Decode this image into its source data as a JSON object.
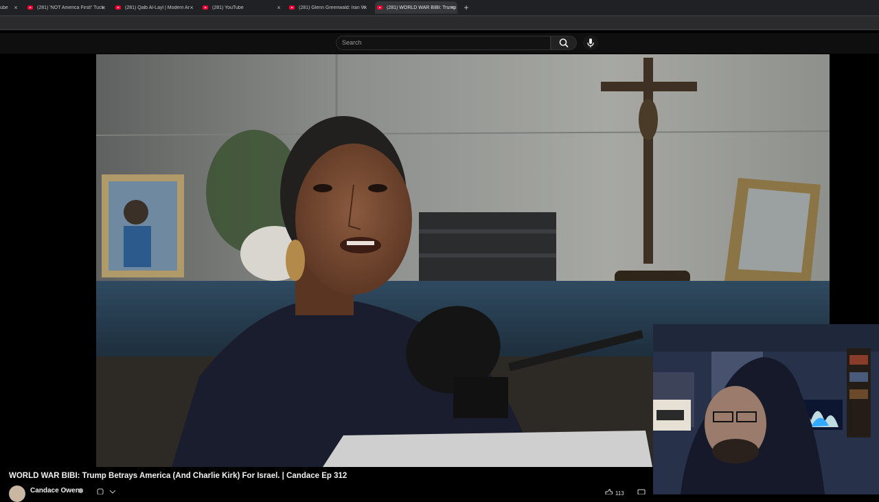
{
  "browser": {
    "tabs": [
      {
        "label": "ube",
        "active": false
      },
      {
        "label": "(281) 'NOT America First!' Tuck",
        "active": false
      },
      {
        "label": "(281) Qalb Al-Layl | Modern Ar",
        "active": false
      },
      {
        "label": "(281) YouTube",
        "active": false
      },
      {
        "label": "(281) Glenn Greenwald: Iran W",
        "active": false
      },
      {
        "label": "(281) WORLD WAR BIBI: Trump",
        "active": true
      }
    ],
    "close_glyph": "×",
    "new_tab_glyph": "+"
  },
  "youtube": {
    "search": {
      "placeholder": "Search"
    },
    "icons": {
      "search": "search-icon",
      "mic": "mic-icon"
    }
  },
  "video": {
    "title": "WORLD WAR BIBI: Trump Betrays America (And Charlie Kirk) For Israel. | Candace Ep 312",
    "channel": "Candace Owens",
    "likes": "113"
  },
  "colors": {
    "tabbar": "#202124",
    "youtube_red": "#ff0033",
    "page_bg": "#0f0f0f"
  }
}
